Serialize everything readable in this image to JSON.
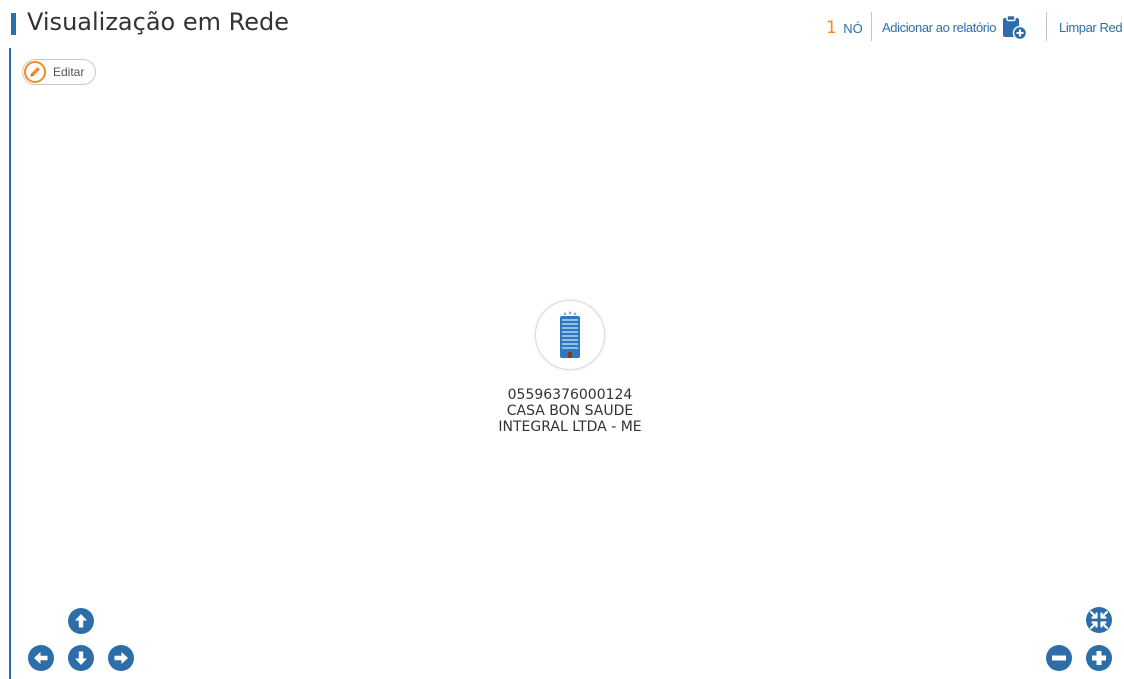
{
  "header": {
    "title": "Visualização em Rede",
    "node_count": {
      "number": "1",
      "label": "NÓ"
    },
    "add_to_report_label": "Adicionar ao relatório",
    "clear_network_label": "Limpar Red"
  },
  "toolbar": {
    "edit_label": "Editar"
  },
  "node": {
    "icon": "building-icon",
    "label_lines": [
      "05596376000124",
      "CASA BON SAUDE",
      "INTEGRAL LTDA - ME"
    ]
  },
  "navigation": {
    "pan_up_icon": "arrow-up-circle-icon",
    "pan_left_icon": "arrow-left-circle-icon",
    "pan_down_icon": "arrow-down-circle-icon",
    "pan_right_icon": "arrow-right-circle-icon",
    "fit_icon": "compress-arrows-icon",
    "zoom_out_icon": "minus-circle-icon",
    "zoom_in_icon": "plus-circle-icon"
  },
  "colors": {
    "primary": "#2e6ea8",
    "accent": "#f08c21",
    "text": "#333333"
  }
}
